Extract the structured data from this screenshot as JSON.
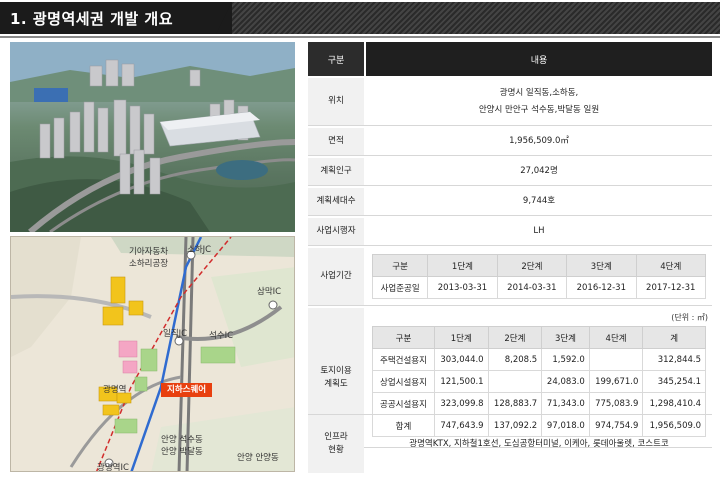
{
  "header": {
    "title": "1. 광명역세권 개발 개요"
  },
  "map": {
    "labels": {
      "kia": "기아자동차",
      "sohari": "소하리공장",
      "sohajc": "소하JC",
      "samakic": "삼막IC",
      "ilzikjc": "일직JC",
      "seoksuic": "석수IC",
      "gwangmyeong_station": "광명역",
      "anyang_seoksu": "안양 석수동",
      "anyang_bakdal": "안양 박달동",
      "anyang_anyang": "안양 안양동",
      "gwangmyeong_ic": "광명역IC"
    },
    "marker": "지하스퀘어"
  },
  "table": {
    "header": {
      "label": "구분",
      "value": "내용"
    },
    "location": {
      "label": "위치",
      "line1": "광명시 일직동,소하동,",
      "line2": "안양시 만안구 석수동,박달동 일원"
    },
    "area": {
      "label": "면적",
      "value": "1,956,509.0㎡"
    },
    "population": {
      "label": "계획인구",
      "value": "27,042명"
    },
    "households": {
      "label": "계획세대수",
      "value": "9,744호"
    },
    "operator": {
      "label": "사업시행자",
      "value": "LH"
    },
    "period": {
      "label": "사업기간",
      "headers": [
        "구분",
        "1단계",
        "2단계",
        "3단계",
        "4단계"
      ],
      "row": [
        "사업준공일",
        "2013-03-31",
        "2014-03-31",
        "2016-12-31",
        "2017-12-31"
      ]
    },
    "landuse": {
      "label_line1": "토지이용",
      "label_line2": "계획도",
      "unit": "(단위 : ㎡)",
      "headers": [
        "구분",
        "1단계",
        "2단계",
        "3단계",
        "4단계",
        "계"
      ],
      "rows": [
        [
          "주택건설용지",
          "303,044.0",
          "8,208.5",
          "1,592.0",
          "",
          "312,844.5"
        ],
        [
          "상업시설용지",
          "121,500.1",
          "",
          "24,083.0",
          "199,671.0",
          "345,254.1"
        ],
        [
          "공공시설용지",
          "323,099.8",
          "128,883.7",
          "71,343.0",
          "775,083.9",
          "1,298,410.4"
        ],
        [
          "합계",
          "747,643.9",
          "137,092.2",
          "97,018.0",
          "974,754.9",
          "1,956,509.0"
        ]
      ]
    },
    "infra": {
      "label_line1": "인프라",
      "label_line2": "현황",
      "value": "광명역KTX, 지하철1호선, 도심공항터미널, 이케아, 롯데아울렛, 코스트코"
    }
  }
}
